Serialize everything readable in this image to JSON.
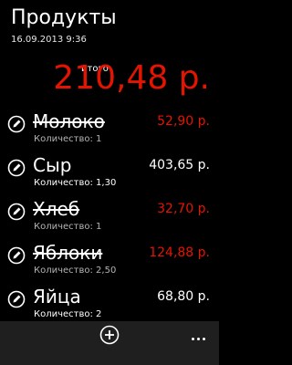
{
  "header": {
    "title": "Продукты",
    "date": "16.09.2013 9:36"
  },
  "total": {
    "label": "итого",
    "value": "210,48 р."
  },
  "items": [
    {
      "name": "Молоко",
      "quantity": "Количество: 1",
      "price": "52,90 р.",
      "purchased": true
    },
    {
      "name": "Сыр",
      "quantity": "Количество: 1,30",
      "price": "403,65 р.",
      "purchased": false
    },
    {
      "name": "Хлеб",
      "quantity": "Количество: 1",
      "price": "32,70 р.",
      "purchased": true
    },
    {
      "name": "Яблоки",
      "quantity": "Количество: 2,50",
      "price": "124,88 р.",
      "purchased": true
    },
    {
      "name": "Яйца",
      "quantity": "Количество: 2",
      "price": "68,80 р.",
      "purchased": false
    }
  ],
  "colors": {
    "accent_red": "#e51400",
    "background": "#000000",
    "appbar": "#1f1f1f"
  },
  "appbar": {
    "icons": [
      "add-icon",
      "more-icon"
    ]
  }
}
